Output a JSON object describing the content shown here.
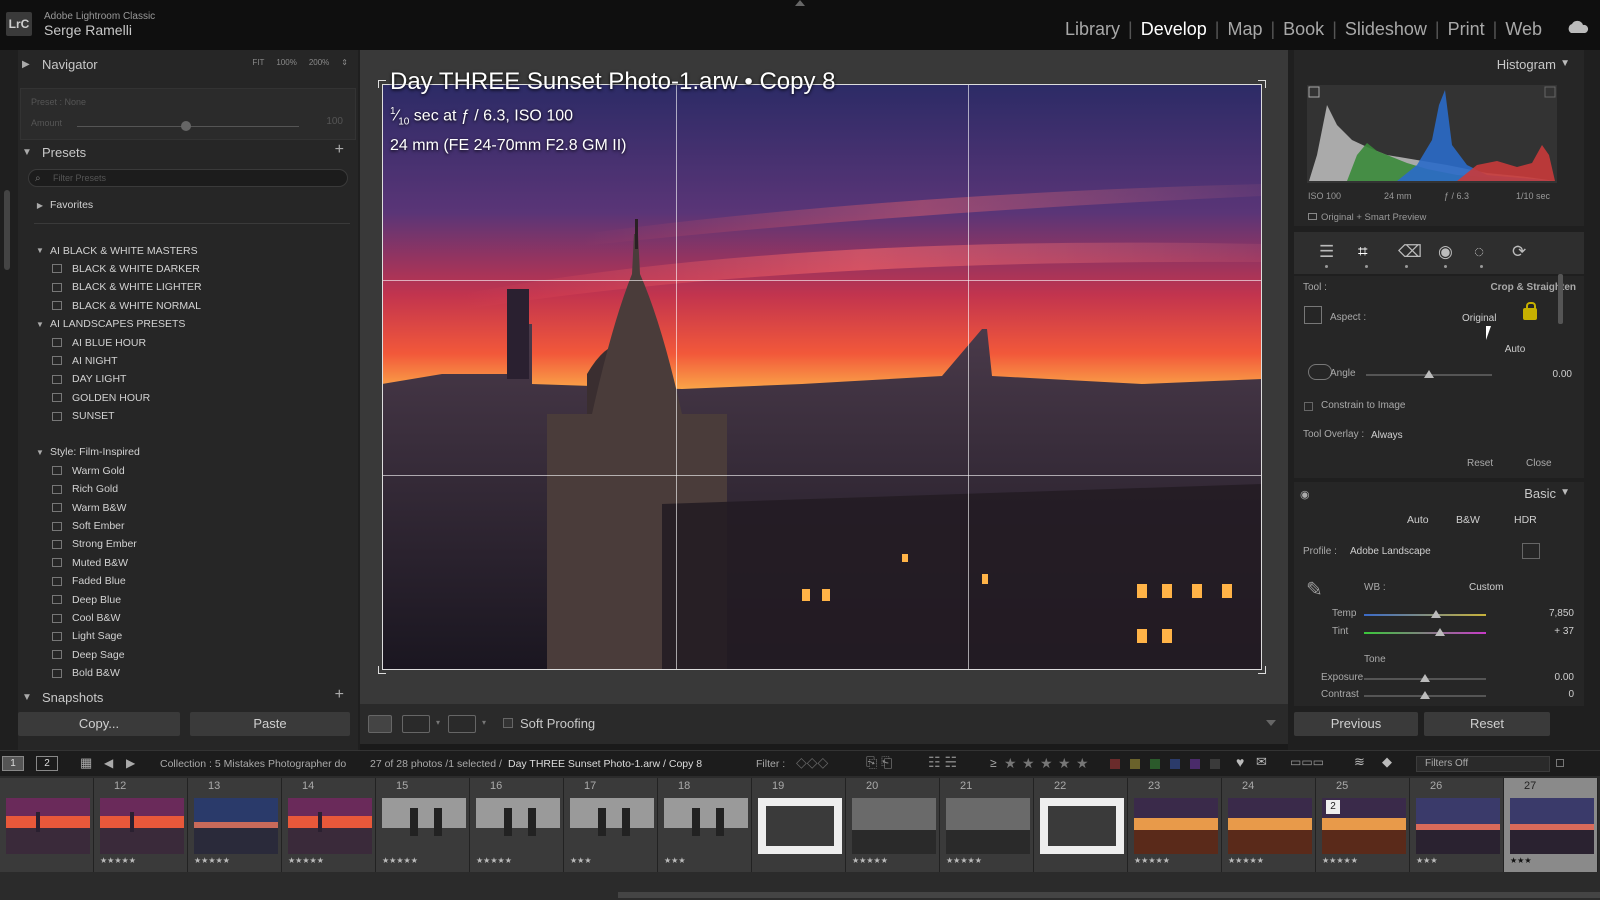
{
  "app": {
    "logo": "LrC",
    "name": "Adobe Lightroom Classic",
    "user": "Serge Ramelli"
  },
  "modules": [
    "Library",
    "Develop",
    "Map",
    "Book",
    "Slideshow",
    "Print",
    "Web"
  ],
  "active_module": "Develop",
  "left": {
    "navigator": {
      "title": "Navigator",
      "zoom": [
        "FIT",
        "100%",
        "200%"
      ],
      "preset_label": "Preset : None",
      "amount_label": "Amount",
      "amount_value": "100"
    },
    "presets": {
      "title": "Presets",
      "search_placeholder": "Filter Presets",
      "rows": [
        {
          "type": "group",
          "caret": "▶",
          "label": "Favorites"
        },
        {
          "type": "gap"
        },
        {
          "type": "group",
          "caret": "▼",
          "label": "AI BLACK & WHITE MASTERS"
        },
        {
          "type": "item",
          "label": "BLACK & WHITE DARKER"
        },
        {
          "type": "item",
          "label": "BLACK & WHITE LIGHTER"
        },
        {
          "type": "item",
          "label": "BLACK & WHITE NORMAL"
        },
        {
          "type": "group",
          "caret": "▼",
          "label": "AI LANDSCAPES PRESETS"
        },
        {
          "type": "item",
          "label": "AI BLUE HOUR"
        },
        {
          "type": "item",
          "label": "AI NIGHT"
        },
        {
          "type": "item",
          "label": "DAY LIGHT"
        },
        {
          "type": "item",
          "label": "GOLDEN HOUR"
        },
        {
          "type": "item",
          "label": "SUNSET"
        },
        {
          "type": "spacer"
        },
        {
          "type": "group",
          "caret": "▼",
          "label": "Style: Film-Inspired"
        },
        {
          "type": "item",
          "label": "Warm Gold"
        },
        {
          "type": "item",
          "label": "Rich Gold"
        },
        {
          "type": "item",
          "label": "Warm B&W"
        },
        {
          "type": "item",
          "label": "Soft Ember"
        },
        {
          "type": "item",
          "label": "Strong Ember"
        },
        {
          "type": "item",
          "label": "Muted B&W"
        },
        {
          "type": "item",
          "label": "Faded Blue"
        },
        {
          "type": "item",
          "label": "Deep Blue"
        },
        {
          "type": "item",
          "label": "Cool B&W"
        },
        {
          "type": "item",
          "label": "Light Sage"
        },
        {
          "type": "item",
          "label": "Deep Sage"
        },
        {
          "type": "item",
          "label": "Bold B&W"
        }
      ]
    },
    "snapshots": {
      "title": "Snapshots"
    },
    "copy_label": "Copy...",
    "paste_label": "Paste"
  },
  "photo": {
    "title": "Day THREE Sunset Photo-1.arw  •  Copy 8",
    "shutter_num": "1",
    "shutter_den": "10",
    "exif_rest": " sec at ƒ / 6.3, ISO 100",
    "lens": "24 mm (FE 24-70mm F2.8 GM II)"
  },
  "toolbar": {
    "soft_proofing": "Soft Proofing"
  },
  "right": {
    "histogram": {
      "title": "Histogram",
      "iso": "ISO 100",
      "focal": "24 mm",
      "aperture": "ƒ / 6.3",
      "shutter": "1/10 sec",
      "preview": "Original + Smart Preview"
    },
    "crop": {
      "tool_label": "Tool :",
      "tool_value": "Crop & Straighten",
      "aspect_label": "Aspect :",
      "aspect_value": "Original",
      "auto": "Auto",
      "angle_label": "Angle",
      "angle_value": "0.00",
      "angle_level": 0.5,
      "constrain": "Constrain to Image",
      "overlay_label": "Tool Overlay :",
      "overlay_value": "Always",
      "reset": "Reset",
      "close": "Close"
    },
    "basic": {
      "title": "Basic",
      "auto": "Auto",
      "bw": "B&W",
      "hdr": "HDR",
      "profile_label": "Profile :",
      "profile_value": "Adobe Landscape",
      "wb_label": "WB :",
      "wb_value": "Custom",
      "temp_label": "Temp",
      "temp_value": "7,850",
      "temp_level": 0.59,
      "tint_label": "Tint",
      "tint_value": "+ 37",
      "tint_level": 0.62,
      "tone_label": "Tone",
      "exposure_label": "Exposure",
      "exposure_value": "0.00",
      "exposure_level": 0.5,
      "contrast_label": "Contrast",
      "contrast_value": "0",
      "contrast_level": 0.5
    },
    "previous_label": "Previous",
    "reset_label": "Reset"
  },
  "filmbar": {
    "screen1": "1",
    "screen2": "2",
    "collection": "Collection : 5 Mistakes Photographer do",
    "count": "27 of 28 photos /1 selected /",
    "current": "Day THREE Sunset Photo-1.arw / Copy 8",
    "filter_label": "Filter :",
    "gte": "≥",
    "filters_off": "Filters Off"
  },
  "filmstrip": [
    {
      "num": "",
      "stars": "",
      "kind": "sunset"
    },
    {
      "num": "12",
      "stars": "★★★★★",
      "kind": "sunset"
    },
    {
      "num": "13",
      "stars": "★★★★★",
      "kind": "blue"
    },
    {
      "num": "14",
      "stars": "★★★★★",
      "kind": "sunset"
    },
    {
      "num": "15",
      "stars": "★★★★★",
      "kind": "bw"
    },
    {
      "num": "16",
      "stars": "★★★★★",
      "kind": "bw"
    },
    {
      "num": "17",
      "stars": "★★★",
      "kind": "bw"
    },
    {
      "num": "18",
      "stars": "★★★",
      "kind": "bw"
    },
    {
      "num": "19",
      "stars": "",
      "kind": "bwframe"
    },
    {
      "num": "20",
      "stars": "★★★★★",
      "kind": "bwdark"
    },
    {
      "num": "21",
      "stars": "★★★★★",
      "kind": "bwdark"
    },
    {
      "num": "22",
      "stars": "",
      "kind": "bwframe"
    },
    {
      "num": "23",
      "stars": "★★★★★",
      "kind": "mesa"
    },
    {
      "num": "24",
      "stars": "★★★★★",
      "kind": "mesa"
    },
    {
      "num": "25",
      "stars": "★★★★★",
      "kind": "mesa",
      "badge": "2"
    },
    {
      "num": "26",
      "stars": "★★★",
      "kind": "city"
    },
    {
      "num": "27",
      "stars": "★★★",
      "kind": "city",
      "selected": true
    }
  ],
  "colors": {
    "accent": "#ffffff",
    "panel": "#262626",
    "lock": "#c6b000",
    "label_red": "#8a2b2b",
    "label_yellow": "#8a7d2b",
    "label_green": "#2b6a2b",
    "label_blue": "#2b4b8a",
    "label_purple": "#5a2b7a"
  }
}
